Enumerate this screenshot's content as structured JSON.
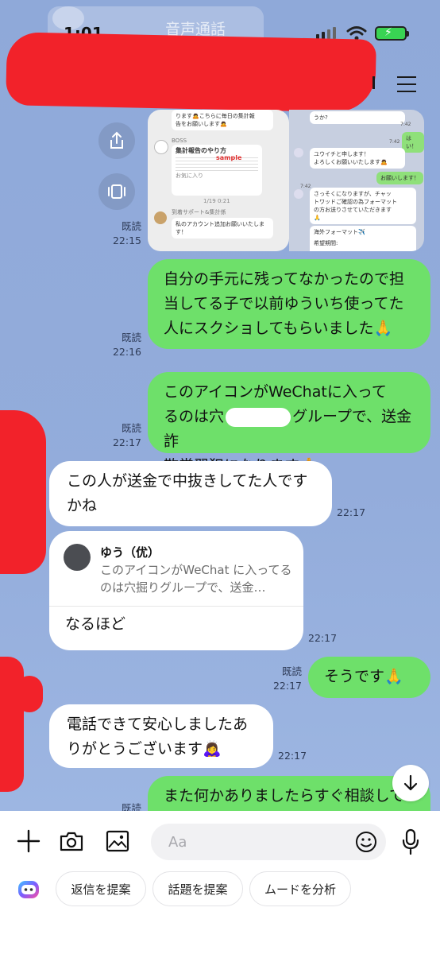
{
  "status_bar": {
    "time": "1:01",
    "call_label": "音声通話"
  },
  "shared_images": {
    "left": {
      "line1": "ります🙇こちらに毎日の集計報",
      "line2": "告をお願いします🙇",
      "boss": "BOSS",
      "doc_title": "集計報告のやり方",
      "doc_sample": "sample",
      "doc_footer": "お気に入り",
      "timestamp": "1/19 0:21",
      "sender": "到着サポート&集計係",
      "msg": "私のアカウント追加お願いいたします！"
    },
    "right": {
      "q": "うか?",
      "time1": "7:42",
      "hai": "はい！",
      "time2": "7:42",
      "intro1": "ユウイチと申します！",
      "intro2": "よろしくお願いいたします🙇",
      "onegai": "お願いします！",
      "time3": "7:42",
      "quick1": "さっそくになりますが、チャッ",
      "quick2": "トワッドご確認の為フォーマット",
      "quick3": "の方お送りさせていただきます",
      "overseas": "海外フォーマット✈️",
      "period": "希望期間:"
    }
  },
  "messages": {
    "m1": {
      "read": "既読",
      "time": "22:15"
    },
    "m2": {
      "text": "自分の手元に残ってなかったので担当してる子で以前ゆういち使ってた人にスクショしてもらいました🙏",
      "read": "既読",
      "time": "22:16"
    },
    "m3": {
      "line1": "このアイコンがWeChatに入って",
      "line2a": "るのは穴",
      "line2b": "グループで、送金詐",
      "line3": "欺常習犯になります🙏",
      "read": "既読",
      "time": "22:17"
    },
    "m4": {
      "text": "この人が送金で中抜きしてた人ですかね",
      "time": "22:17"
    },
    "m5": {
      "quote_name": "ゆう（优）",
      "quote_text": "このアイコンがWeChat に入ってるのは穴掘りグループで、送金…",
      "reply": "なるほど",
      "time": "22:17"
    },
    "m6": {
      "text": "そうです🙏",
      "read": "既読",
      "time": "22:17"
    },
    "m7": {
      "text": "電話できて安心しましたありがとうございます🙇‍♀️",
      "time": "22:17"
    },
    "m8": {
      "text": "また何かありましたらすぐ相談してください🙏",
      "read": "既読"
    }
  },
  "input": {
    "placeholder": "Aa"
  },
  "suggestions": [
    "返信を提案",
    "話題を提案",
    "ムードを分析"
  ],
  "colors": {
    "chat_bg": "#8fa9d9",
    "outgoing_bubble": "#6ee06a",
    "incoming_bubble": "#ffffff",
    "redaction": "#f2222a"
  }
}
